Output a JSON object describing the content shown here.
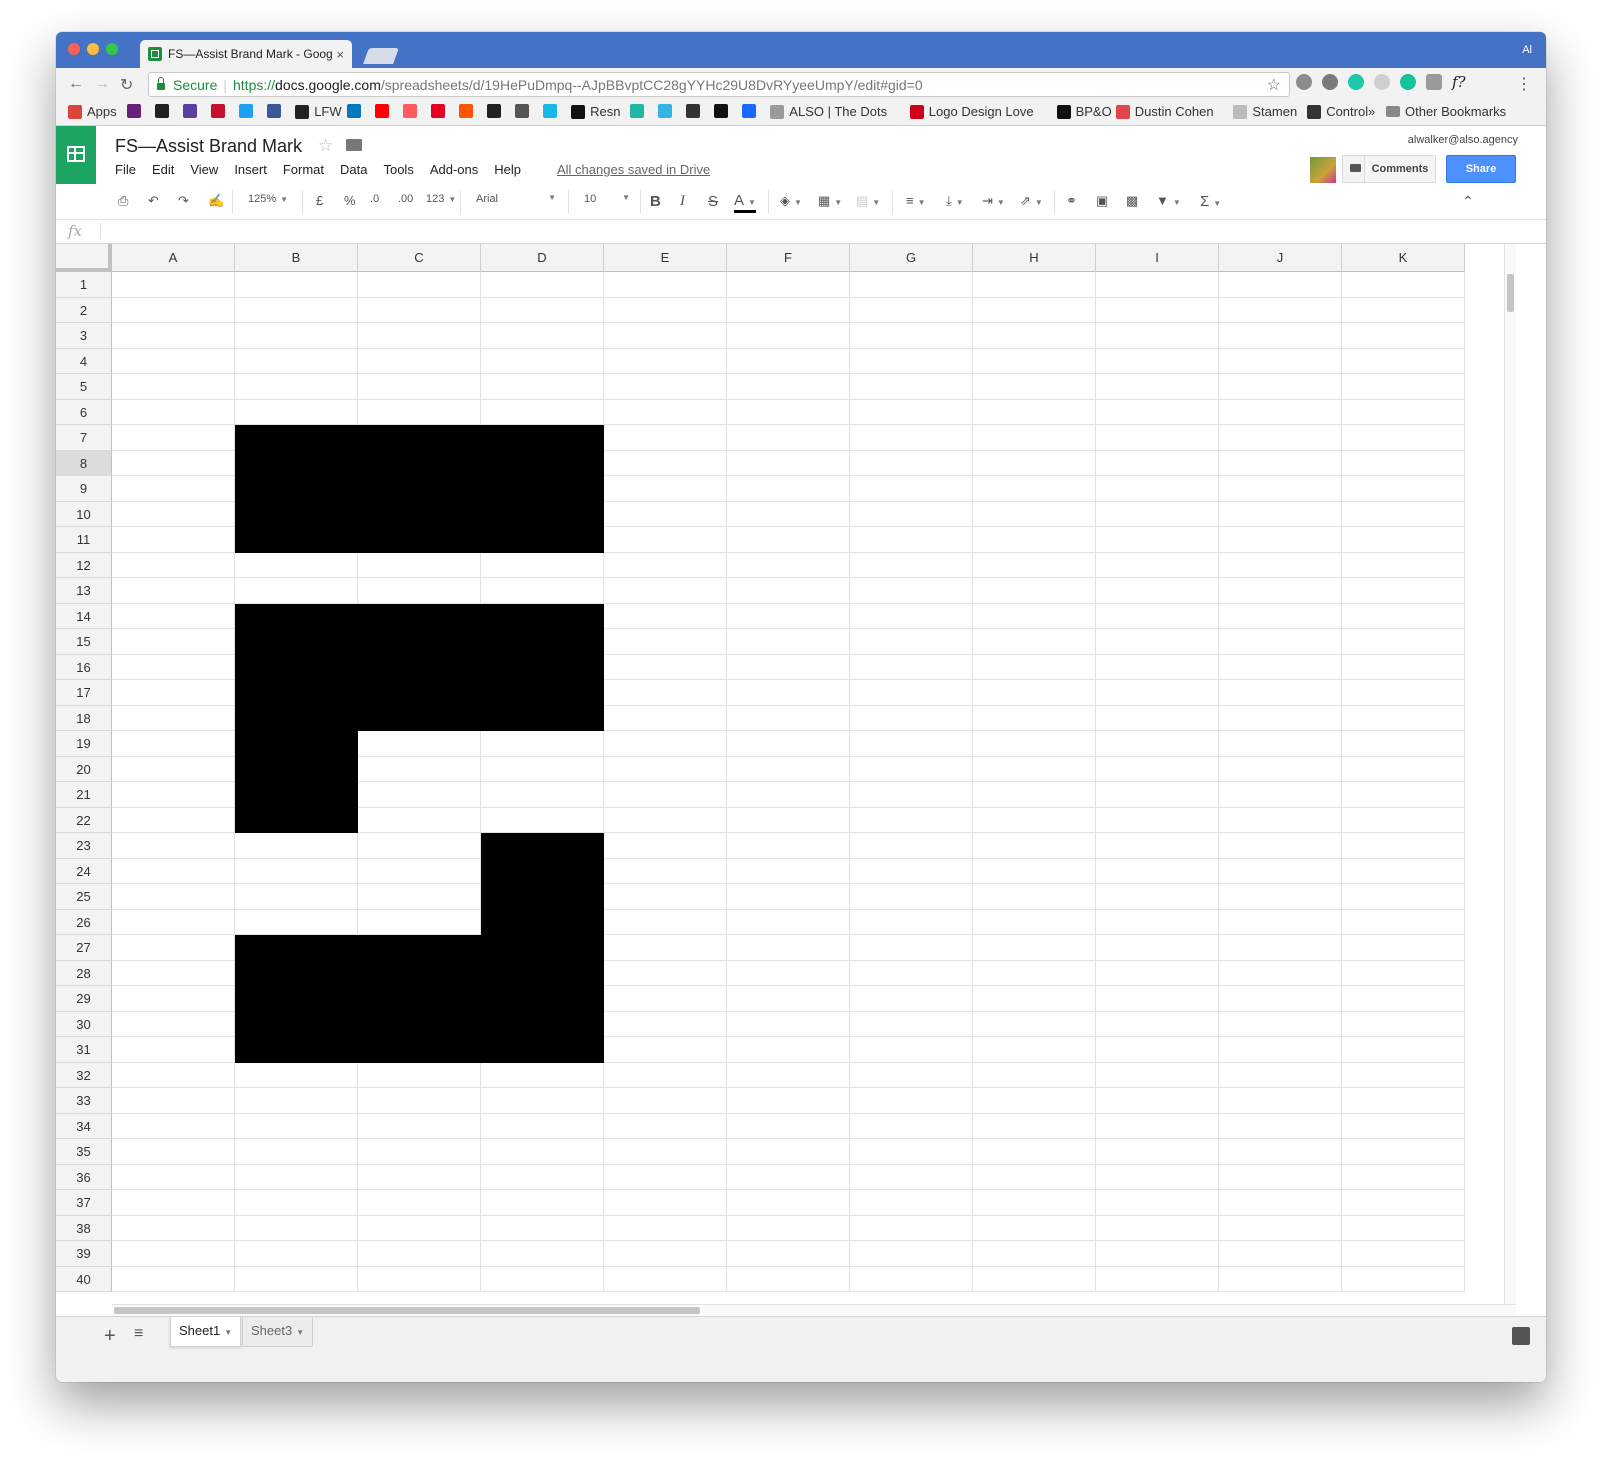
{
  "colors": {
    "accent": "#4472c4",
    "sheets_green": "#1da462",
    "share_blue": "#4d90fe",
    "fill": "#000000"
  },
  "browser": {
    "tab_title": "FS—Assist Brand Mark - Goog",
    "tab_close": "×",
    "profile_initials": "Al",
    "secure_label": "Secure",
    "url_scheme": "https://",
    "url_host": "docs.google.com",
    "url_rest": "/spreadsheets/d/19HePuDmpq--AJpBBvptCC28gYYHc29U8DvRYyeeUmpY/edit#gid=0",
    "ext_fq": "f?",
    "bookmarks": [
      {
        "label": "Apps",
        "icon": "apps-grid-icon",
        "color": "#db4437"
      },
      {
        "label": "",
        "icon": "visual-studio-icon",
        "color": "#68217a"
      },
      {
        "label": "",
        "icon": "we-icon",
        "color": "#222222"
      },
      {
        "label": "",
        "icon": "bookmark-icon-3",
        "color": "#5b3fa1"
      },
      {
        "label": "",
        "icon": "bookmark-icon-4",
        "color": "#c8102e"
      },
      {
        "label": "",
        "icon": "twitter-icon",
        "color": "#1da1f2"
      },
      {
        "label": "",
        "icon": "facebook-icon",
        "color": "#3b5998"
      },
      {
        "label": "LFW",
        "icon": "lfw-icon",
        "color": "#222222"
      },
      {
        "label": "",
        "icon": "trello-icon",
        "color": "#0079bf"
      },
      {
        "label": "",
        "icon": "youtube-icon",
        "color": "#ff0000"
      },
      {
        "label": "",
        "icon": "airbnb-icon",
        "color": "#ff5a5f"
      },
      {
        "label": "",
        "icon": "pinterest-icon",
        "color": "#e60023"
      },
      {
        "label": "",
        "icon": "soundcloud-icon",
        "color": "#ff5500"
      },
      {
        "label": "",
        "icon": "asterisk-icon",
        "color": "#222222"
      },
      {
        "label": "",
        "icon": "wikipedia-icon",
        "color": "#555555"
      },
      {
        "label": "",
        "icon": "vimeo-icon",
        "color": "#1ab7ea"
      },
      {
        "label": "Resn",
        "icon": "resn-icon",
        "color": "#111111"
      },
      {
        "label": "",
        "icon": "bookmark-icon-18",
        "color": "#21b7a3"
      },
      {
        "label": "",
        "icon": "bookmark-icon-19",
        "color": "#35b4e6"
      },
      {
        "label": "",
        "icon": "bookmark-icon-20",
        "color": "#333333"
      },
      {
        "label": "",
        "icon": "id-icon",
        "color": "#111111"
      },
      {
        "label": "",
        "icon": "behance-icon",
        "color": "#1769ff"
      },
      {
        "label": "ALSO | The Dots",
        "icon": "the-dots-icon",
        "color": "#9a9a9a"
      },
      {
        "label": "Logo Design Love",
        "icon": "heart-icon",
        "color": "#d0021b"
      },
      {
        "label": "BP&O",
        "icon": "bpo-icon",
        "color": "#111111"
      },
      {
        "label": "Dustin Cohen",
        "icon": "dustin-cohen-icon",
        "color": "#e0454b"
      },
      {
        "label": "Stamen",
        "icon": "page-icon",
        "color": "#bbbbbb"
      },
      {
        "label": "Control",
        "icon": "control-icon",
        "color": "#333333"
      }
    ],
    "bookmarks_more": "»",
    "other_bookmarks": "Other Bookmarks"
  },
  "sheets": {
    "doc_title": "FS—Assist Brand Mark",
    "menu": [
      "File",
      "Edit",
      "View",
      "Insert",
      "Format",
      "Data",
      "Tools",
      "Add-ons",
      "Help"
    ],
    "save_status": "All changes saved in Drive",
    "user_email": "alwalker@also.agency",
    "comments_label": "Comments",
    "share_label": "Share",
    "toolbar": {
      "zoom": "125%",
      "currency": "£",
      "percent": "%",
      "dec_decrease": ".0",
      "dec_increase": ".00",
      "more_formats": "123",
      "font": "Arial",
      "font_size": "10",
      "bold": "B",
      "italic": "I",
      "strike": "S",
      "text_color": "A",
      "functions": "Σ"
    },
    "formula_icon": "fx",
    "columns": [
      "A",
      "B",
      "C",
      "D",
      "E",
      "F",
      "G",
      "H",
      "I",
      "J",
      "K"
    ],
    "row_count": 40,
    "selected_row": 8,
    "filled_cells": {
      "7": [
        "B",
        "C",
        "D"
      ],
      "8": [
        "B",
        "C",
        "D"
      ],
      "9": [
        "B",
        "C",
        "D"
      ],
      "10": [
        "B",
        "C",
        "D"
      ],
      "11": [
        "B",
        "C",
        "D"
      ],
      "14": [
        "B",
        "C",
        "D"
      ],
      "15": [
        "B",
        "C",
        "D"
      ],
      "16": [
        "B",
        "C",
        "D"
      ],
      "17": [
        "B",
        "C",
        "D"
      ],
      "18": [
        "B",
        "C",
        "D"
      ],
      "19": [
        "B"
      ],
      "20": [
        "B"
      ],
      "21": [
        "B"
      ],
      "22": [
        "B"
      ],
      "23": [
        "D"
      ],
      "24": [
        "D"
      ],
      "25": [
        "D"
      ],
      "26": [
        "D"
      ],
      "27": [
        "B",
        "C",
        "D"
      ],
      "28": [
        "B",
        "C",
        "D"
      ],
      "29": [
        "B",
        "C",
        "D"
      ],
      "30": [
        "B",
        "C",
        "D"
      ],
      "31": [
        "B",
        "C",
        "D"
      ]
    },
    "add_sheet": "+",
    "all_sheets": "≡",
    "tabs": [
      {
        "label": "Sheet1",
        "active": true
      },
      {
        "label": "Sheet3",
        "active": false
      }
    ]
  }
}
